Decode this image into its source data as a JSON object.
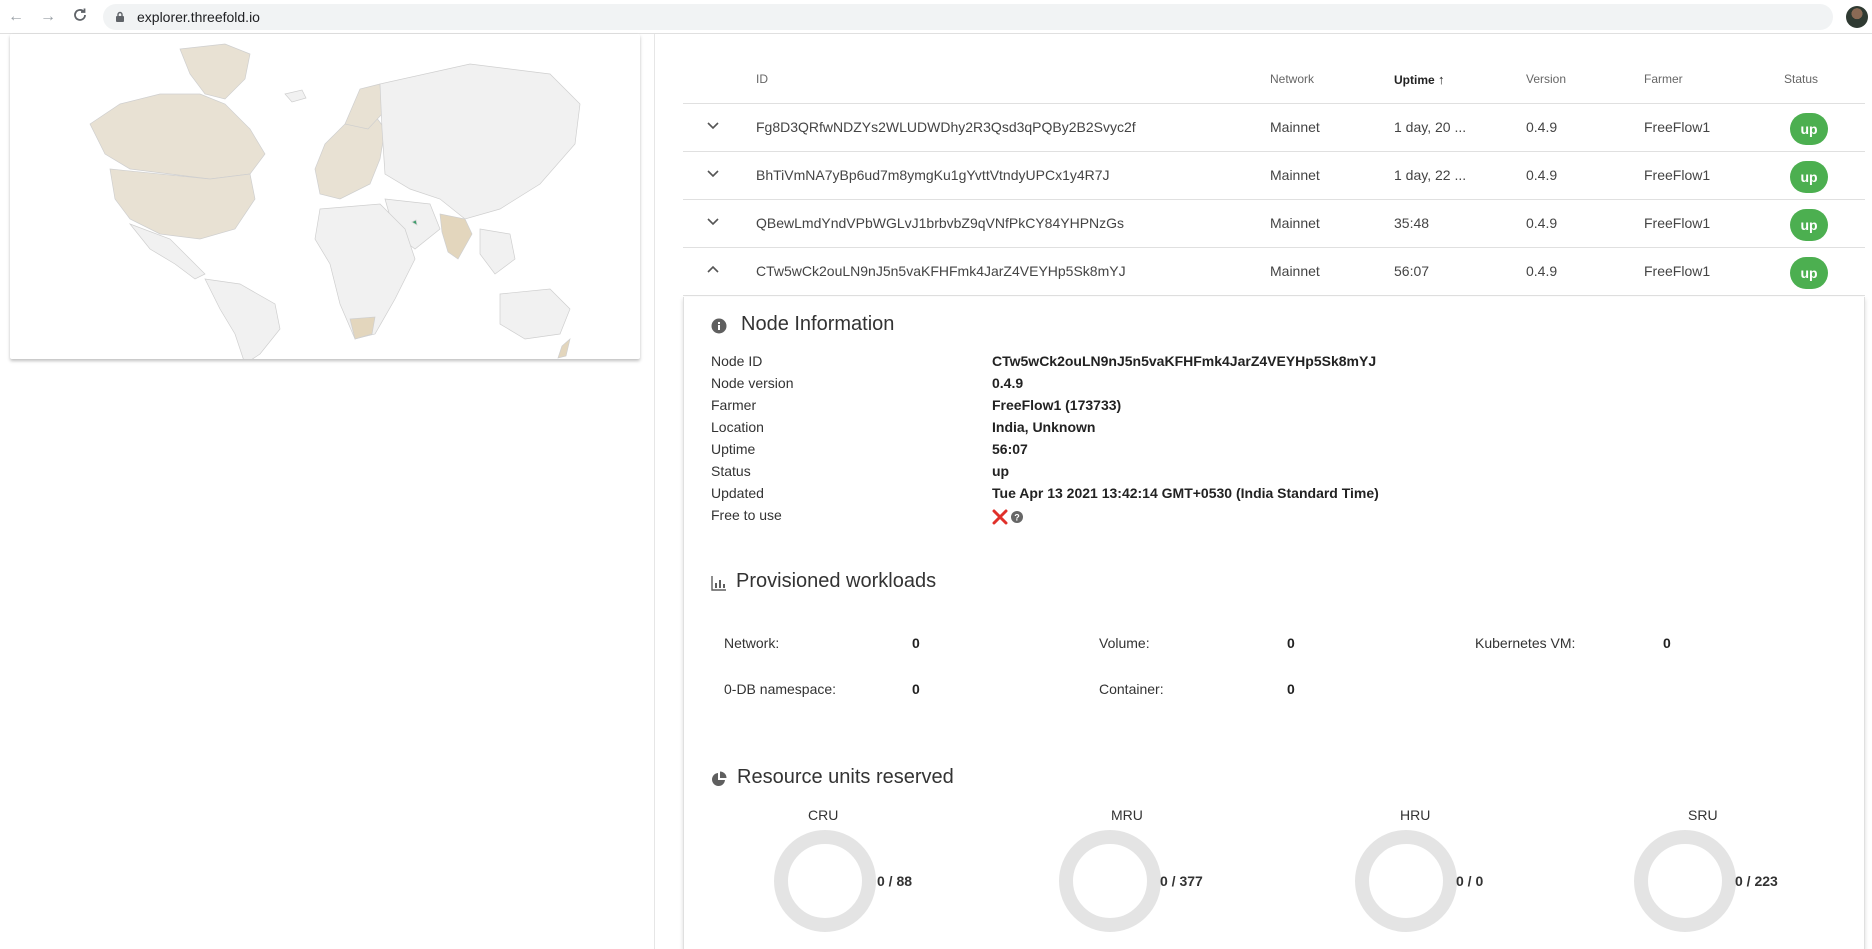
{
  "browser": {
    "url": "explorer.threefold.io",
    "icons": [
      "back-icon",
      "forward-icon",
      "reload-icon",
      "lock-icon",
      "star-icon"
    ]
  },
  "table": {
    "headers": {
      "id": "ID",
      "network": "Network",
      "uptime": "Uptime",
      "version": "Version",
      "farmer": "Farmer",
      "status": "Status"
    },
    "rows": [
      {
        "id": "Fg8D3QRfwNDZYs2WLUDWDhy2R3Qsd3qPQBy2B2Svyc2f",
        "network": "Mainnet",
        "uptime": "1 day, 20 ...",
        "version": "0.4.9",
        "farmer": "FreeFlow1",
        "status": "up",
        "expanded": false
      },
      {
        "id": "BhTiVmNA7yBp6ud7m8ymgKu1gYvttVtndyUPCx1y4R7J",
        "network": "Mainnet",
        "uptime": "1 day, 22 ...",
        "version": "0.4.9",
        "farmer": "FreeFlow1",
        "status": "up",
        "expanded": false
      },
      {
        "id": "QBewLmdYndVPbWGLvJ1brbvbZ9qVNfPkCY84YHPNzGs",
        "network": "Mainnet",
        "uptime": "35:48",
        "version": "0.4.9",
        "farmer": "FreeFlow1",
        "status": "up",
        "expanded": false
      },
      {
        "id": "CTw5wCk2ouLN9nJ5n5vaKFHFmk4JarZ4VEYHp5Sk8mYJ",
        "network": "Mainnet",
        "uptime": "56:07",
        "version": "0.4.9",
        "farmer": "FreeFlow1",
        "status": "up",
        "expanded": true
      }
    ],
    "status_color": "#4caf50"
  },
  "node_info": {
    "title": "Node Information",
    "fields": [
      {
        "label": "Node ID",
        "value": "CTw5wCk2ouLN9nJ5n5vaKFHFmk4JarZ4VEYHp5Sk8mYJ"
      },
      {
        "label": "Node version",
        "value": "0.4.9"
      },
      {
        "label": "Farmer",
        "value": "FreeFlow1 (173733)"
      },
      {
        "label": "Location",
        "value": "India, Unknown"
      },
      {
        "label": "Uptime",
        "value": "56:07"
      },
      {
        "label": "Status",
        "value": "up"
      },
      {
        "label": "Updated",
        "value": "Tue Apr 13 2021 13:42:14 GMT+0530 (India Standard Time)"
      },
      {
        "label": "Free to use",
        "value": ""
      }
    ],
    "free_to_use_icons": [
      "cross-icon",
      "help-icon"
    ]
  },
  "workloads": {
    "title": "Provisioned workloads",
    "items": [
      {
        "label": "Network:",
        "value": "0"
      },
      {
        "label": "Volume:",
        "value": "0"
      },
      {
        "label": "Kubernetes VM:",
        "value": "0"
      },
      {
        "label": "0-DB namespace:",
        "value": "0"
      },
      {
        "label": "Container:",
        "value": "0"
      }
    ]
  },
  "resources": {
    "title": "Resource units reserved",
    "units": [
      {
        "label": "CRU",
        "value": "0 / 88"
      },
      {
        "label": "MRU",
        "value": "0 / 377"
      },
      {
        "label": "HRU",
        "value": "0 / 0"
      },
      {
        "label": "SRU",
        "value": "0 / 223"
      }
    ]
  }
}
